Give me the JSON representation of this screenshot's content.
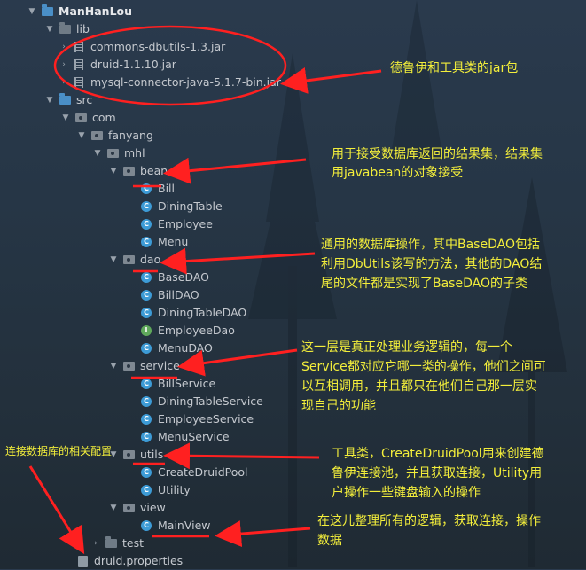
{
  "tree": {
    "root": "ManHanLou",
    "lib": "lib",
    "jars": [
      "commons-dbutils-1.3.jar",
      "druid-1.1.10.jar",
      "mysql-connector-java-5.1.7-bin.jar"
    ],
    "src": "src",
    "com": "com",
    "fanyang": "fanyang",
    "mhl": "mhl",
    "bean": "bean",
    "bean_items": [
      "Bill",
      "DiningTable",
      "Employee",
      "Menu"
    ],
    "dao": "dao",
    "dao_items": [
      "BaseDAO",
      "BillDAO",
      "DiningTableDAO",
      "EmployeeDao",
      "MenuDAO"
    ],
    "service": "service",
    "service_items": [
      "BillService",
      "DiningTableService",
      "EmployeeService",
      "MenuService"
    ],
    "utils": "utils",
    "utils_items": [
      "CreateDruidPool",
      "Utility"
    ],
    "view": "view",
    "view_items": [
      "MainView"
    ],
    "test": "test",
    "props": "druid.properties"
  },
  "annotations": {
    "jars": "德鲁伊和工具类的jar包",
    "bean_1": "用于接受数据库返回的结果集，结果集",
    "bean_2": "用javabean的对象接受",
    "dao_1": "通用的数据库操作，其中BaseDAO包括",
    "dao_2": "利用DbUtils该写的方法，其他的DAO结",
    "dao_3": "尾的文件都是实现了BaseDAO的子类",
    "service_1": "这一层是真正处理业务逻辑的，每一个",
    "service_2": "Service都对应它哪一类的操作，他们之间可",
    "service_3": "以互相调用，并且都只在他们自己那一层实",
    "service_4": "现自己的功能",
    "utils_1": "工具类，CreateDruidPool用来创建德",
    "utils_2": "鲁伊连接池，并且获取连接，Utility用",
    "utils_3": "户操作一些键盘输入的操作",
    "view_1": "在这儿整理所有的逻辑，获取连接，操作",
    "view_2": "数据",
    "config": "连接数据库的相关配置"
  },
  "colors": {
    "annotation": "#f3ee3b",
    "arrow": "#ff2020",
    "class_icon": "#3d9bd6",
    "interface_icon": "#5fa85b",
    "folder_blue": "#4a8fc7"
  }
}
